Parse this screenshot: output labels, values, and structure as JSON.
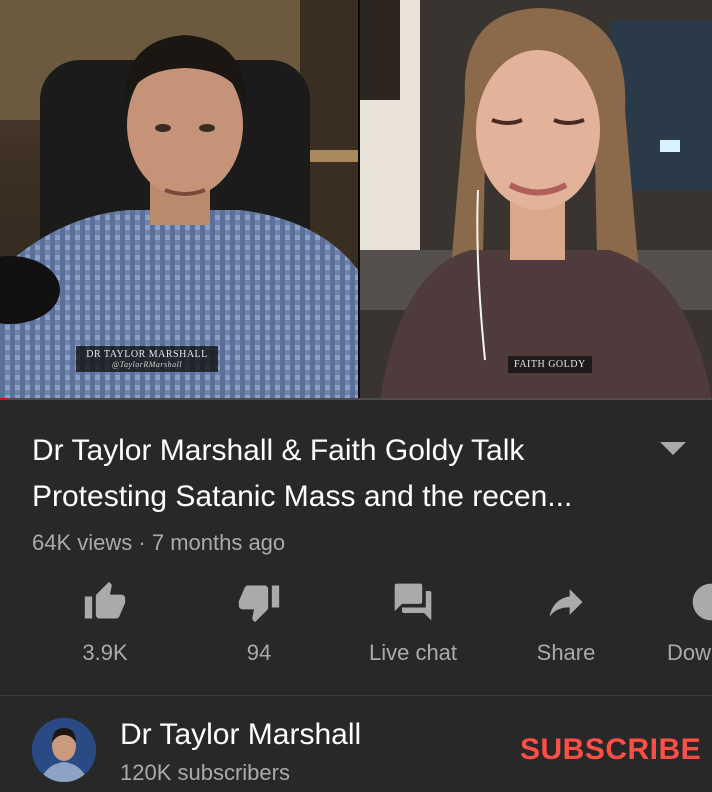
{
  "video": {
    "left_nametag_line1": "DR TAYLOR MARSHALL",
    "left_nametag_line2": "@TaylorRMarshall",
    "right_nametag": "FAITH GOLDY",
    "progress_fraction": 0.01
  },
  "title": {
    "line1": "Dr Taylor Marshall & Faith Goldy Talk",
    "line2": "Protesting Satanic Mass and the recen..."
  },
  "meta": {
    "views": "64K views",
    "separator": " · ",
    "age": "7 months ago"
  },
  "actions": [
    {
      "label": "3.9K",
      "icon": "thumbs-up-icon"
    },
    {
      "label": "94",
      "icon": "thumbs-down-icon"
    },
    {
      "label": "Live chat",
      "icon": "live-chat-icon"
    },
    {
      "label": "Share",
      "icon": "share-icon"
    },
    {
      "label": "Dow",
      "icon": "download-icon"
    }
  ],
  "channel": {
    "name": "Dr Taylor Marshall",
    "subscribers": "120K subscribers",
    "subscribe_label": "SUBSCRIBE"
  },
  "colors": {
    "background": "#282828",
    "subscribe": "#ff4e45",
    "secondary_text": "#aaaaaa",
    "progress": "#ee0000"
  }
}
